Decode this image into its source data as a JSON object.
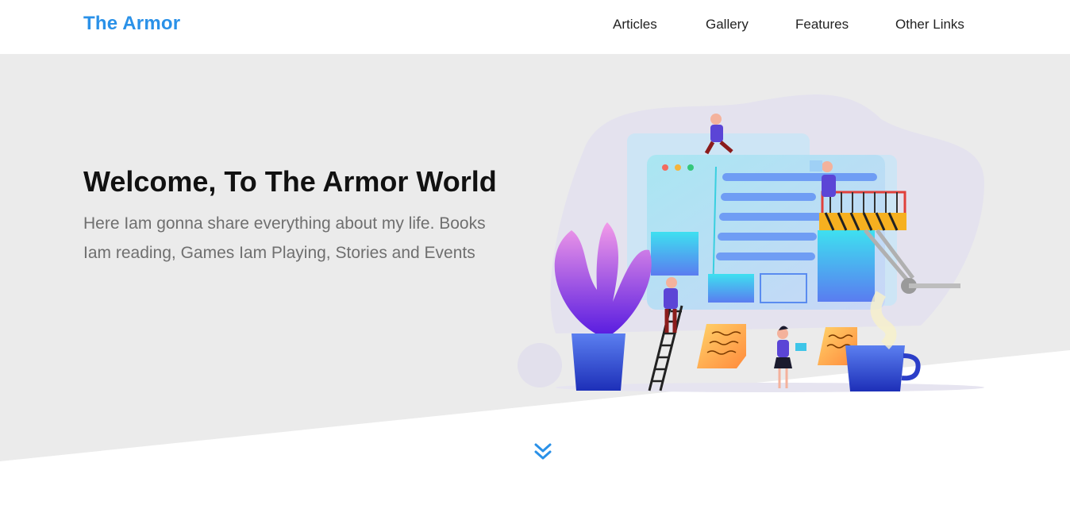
{
  "header": {
    "logo": "The Armor",
    "nav": [
      "Articles",
      "Gallery",
      "Features",
      "Other Links"
    ]
  },
  "hero": {
    "title": "Welcome, To The Armor World",
    "text": "Here Iam gonna share everything about my life. Books Iam reading, Games Iam Playing, Stories and Events"
  },
  "icons": {
    "scroll_down": "double-chevron-down-icon"
  },
  "colors": {
    "brand": "#2a91e8",
    "hero_background": "#ebebeb",
    "title": "#111111",
    "body_text": "#6f6f6f"
  }
}
